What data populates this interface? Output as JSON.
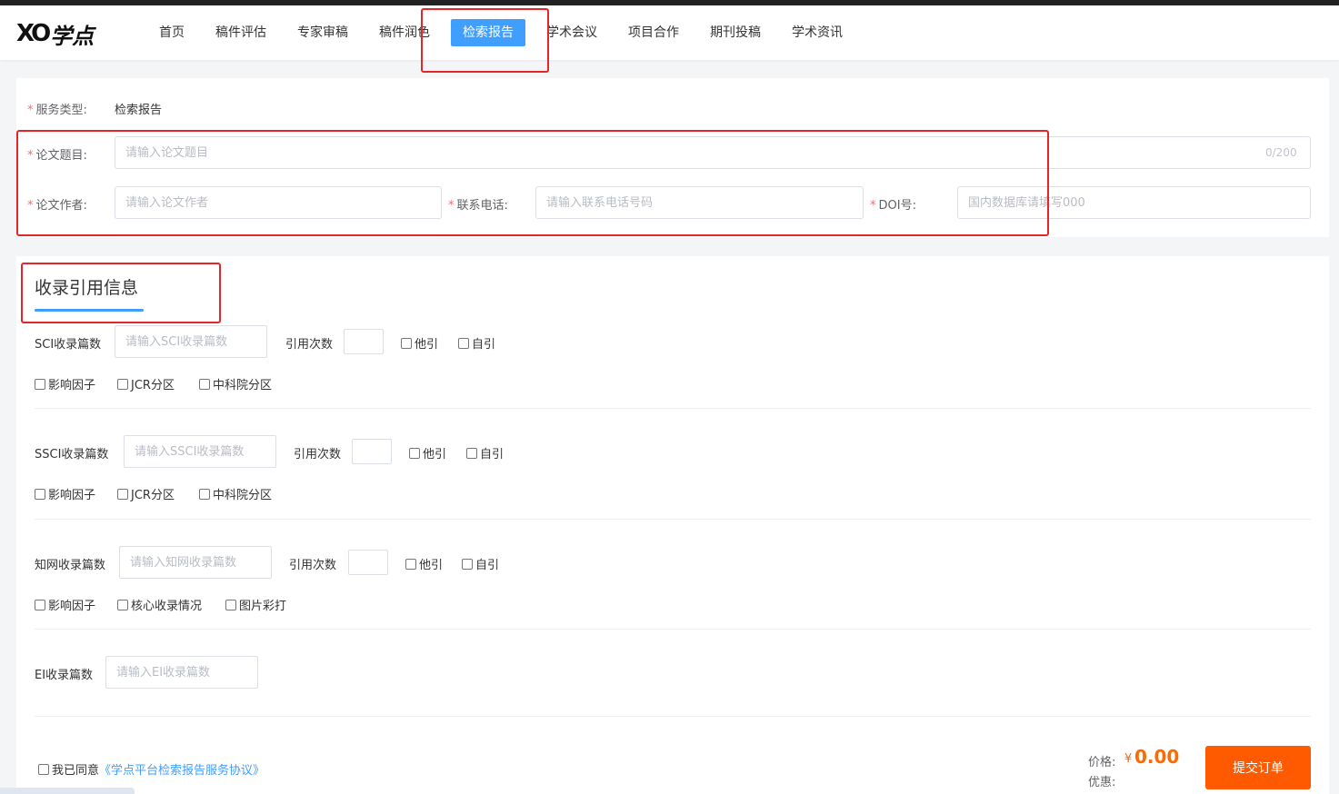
{
  "nav": {
    "items": [
      {
        "label": "首页",
        "active": false
      },
      {
        "label": "稿件评估",
        "active": false
      },
      {
        "label": "专家审稿",
        "active": false
      },
      {
        "label": "稿件润色",
        "active": false
      },
      {
        "label": "检索报告",
        "active": true
      },
      {
        "label": "学术会议",
        "active": false
      },
      {
        "label": "项目合作",
        "active": false
      },
      {
        "label": "期刊投稿",
        "active": false
      },
      {
        "label": "学术资讯",
        "active": false
      }
    ]
  },
  "logo": {
    "mark": "XO",
    "text": "学点"
  },
  "basic": {
    "service_type_label": "服务类型:",
    "service_type_value": "检索报告",
    "title_label": "论文题目:",
    "title_placeholder": "请输入论文题目",
    "title_counter": "0/200",
    "author_label": "论文作者:",
    "author_placeholder": "请输入论文作者",
    "phone_label": "联系电话:",
    "phone_placeholder": "请输入联系电话号码",
    "doi_label": "DOI号:",
    "doi_placeholder": "国内数据库请填写000",
    "required_mark": "*"
  },
  "citation": {
    "section_title": "收录引用信息",
    "cite_count_label": "引用次数",
    "other_cite": "他引",
    "self_cite": "自引",
    "sci": {
      "label": "SCI收录篇数",
      "placeholder": "请输入SCI收录篇数",
      "options": [
        "影响因子",
        "JCR分区",
        "中科院分区"
      ]
    },
    "ssci": {
      "label": "SSCI收录篇数",
      "placeholder": "请输入SSCI收录篇数",
      "options": [
        "影响因子",
        "JCR分区",
        "中科院分区"
      ]
    },
    "cnki": {
      "label": "知网收录篇数",
      "placeholder": "请输入知网收录篇数",
      "options": [
        "影响因子",
        "核心收录情况",
        "图片彩打"
      ]
    },
    "ei": {
      "label": "EI收录篇数",
      "placeholder": "请输入EI收录篇数"
    }
  },
  "footer": {
    "agree_text": "我已同意",
    "agree_link": "《学点平台检索报告服务协议》",
    "price_label": "价格:",
    "currency": "¥",
    "price": "0.00",
    "discount_label": "优惠:",
    "submit_label": "提交订单"
  },
  "colors": {
    "accent": "#409eff",
    "price": "#ff6a00",
    "submit": "#ff5a00",
    "highlight": "#e5252a"
  }
}
